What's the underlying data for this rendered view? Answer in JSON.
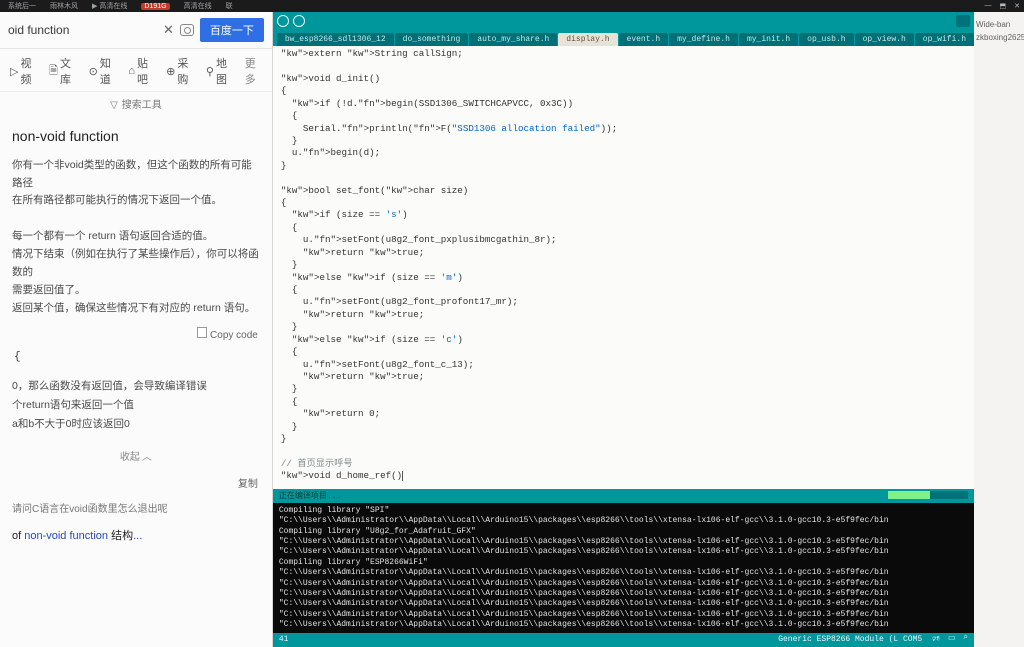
{
  "taskbar": {
    "items": [
      "系统后一",
      "雨林木风",
      "高清在线",
      "D191G",
      "高清在线",
      "联"
    ],
    "win": [
      "—",
      "⬒",
      "✕"
    ]
  },
  "left": {
    "search_title": "oid function",
    "baidu": "百度一下",
    "tabs": [
      "视频",
      "文库",
      "知道",
      "贴吧",
      "采购",
      "地图"
    ],
    "more": "更多",
    "tools": "搜索工具",
    "heading": "non-void function",
    "p1": "你有一个非void类型的函数，但这个函数的所有可能路径",
    "p2": "在所有路径都可能执行的情况下返回一个值。",
    "p3": "每一个都有一个 return 语句返回合适的值。",
    "p4": "情况下结束（例如在执行了某些操作后），你可以将函数的",
    "p5": "需要返回值了。",
    "p6": "返回某个值，确保这些情况下有对应的 return 语句。",
    "copy": "Copy code",
    "code_line": "{",
    "r1": "0，那么函数没有返回值，会导致编译错误",
    "r2": "个return语句来返回一个值",
    "r3": "a和b不大于0时应该返回0",
    "collapse": "收起",
    "copy2": "复制",
    "ask": "请问C语言在void函数里怎么退出呢",
    "related_pre": "of ",
    "related_link": "non-void function",
    "related_post": " 结构",
    "dots": "..."
  },
  "ide": {
    "file_tabs": [
      "bw_esp8266_sdl1306_12",
      "do_something",
      "auto_my_share.h",
      "display.h",
      "event.h",
      "my_define.h",
      "my_init.h",
      "op_usb.h",
      "op_view.h",
      "op_wifi.h"
    ],
    "active_tab_index": 3,
    "code": "extern String callSign;\n\nvoid d_init()\n{\n  if (!d.begin(SSD1306_SWITCHCAPVCC, 0x3C))\n  {\n    Serial.println(F(\"SSD1306 allocation failed\"));\n  }\n  u.begin(d);\n}\n\nbool set_font(char size)\n{\n  if (size == 's')\n  {\n    u.setFont(u8g2_font_pxplusibmcgathin_8r);\n    return true;\n  }\n  else if (size == 'm')\n  {\n    u.setFont(u8g2_font_profont17_mr);\n    return true;\n  }\n  else if (size == 'c')\n  {\n    u.setFont(u8g2_font_c_13);\n    return true;\n  }\n  {\n    return 0;\n  }\n}\n\n// 首页显示呼号\nvoid d_home_ref()",
    "console_header": "正在编译项目...",
    "console": "Compiling library \"SPI\"\n\"C:\\\\Users\\\\Administrator\\\\AppData\\\\Local\\\\Arduino15\\\\packages\\\\esp8266\\\\tools\\\\xtensa-lx106-elf-gcc\\\\3.1.0-gcc10.3-e5f9fec/bin\nCompiling library \"U8g2_for_Adafruit_GFX\"\n\"C:\\\\Users\\\\Administrator\\\\AppData\\\\Local\\\\Arduino15\\\\packages\\\\esp8266\\\\tools\\\\xtensa-lx106-elf-gcc\\\\3.1.0-gcc10.3-e5f9fec/bin\n\"C:\\\\Users\\\\Administrator\\\\AppData\\\\Local\\\\Arduino15\\\\packages\\\\esp8266\\\\tools\\\\xtensa-lx106-elf-gcc\\\\3.1.0-gcc10.3-e5f9fec/bin\nCompiling library \"ESP8266WiFi\"\n\"C:\\\\Users\\\\Administrator\\\\AppData\\\\Local\\\\Arduino15\\\\packages\\\\esp8266\\\\tools\\\\xtensa-lx106-elf-gcc\\\\3.1.0-gcc10.3-e5f9fec/bin\n\"C:\\\\Users\\\\Administrator\\\\AppData\\\\Local\\\\Arduino15\\\\packages\\\\esp8266\\\\tools\\\\xtensa-lx106-elf-gcc\\\\3.1.0-gcc10.3-e5f9fec/bin\n\"C:\\\\Users\\\\Administrator\\\\AppData\\\\Local\\\\Arduino15\\\\packages\\\\esp8266\\\\tools\\\\xtensa-lx106-elf-gcc\\\\3.1.0-gcc10.3-e5f9fec/bin\n\"C:\\\\Users\\\\Administrator\\\\AppData\\\\Local\\\\Arduino15\\\\packages\\\\esp8266\\\\tools\\\\xtensa-lx106-elf-gcc\\\\3.1.0-gcc10.3-e5f9fec/bin\n\"C:\\\\Users\\\\Administrator\\\\AppData\\\\Local\\\\Arduino15\\\\packages\\\\esp8266\\\\tools\\\\xtensa-lx106-elf-gcc\\\\3.1.0-gcc10.3-e5f9fec/bin\n\"C:\\\\Users\\\\Administrator\\\\AppData\\\\Local\\\\Arduino15\\\\packages\\\\esp8266\\\\tools\\\\xtensa-lx106-elf-gcc\\\\3.1.0-gcc10.3-e5f9fec/bin",
    "status_left": "41",
    "status_right": "Generic ESP8266 Module (L COM5"
  },
  "right": {
    "l1": "Wide-ban",
    "l2": "zkboxing2625"
  }
}
